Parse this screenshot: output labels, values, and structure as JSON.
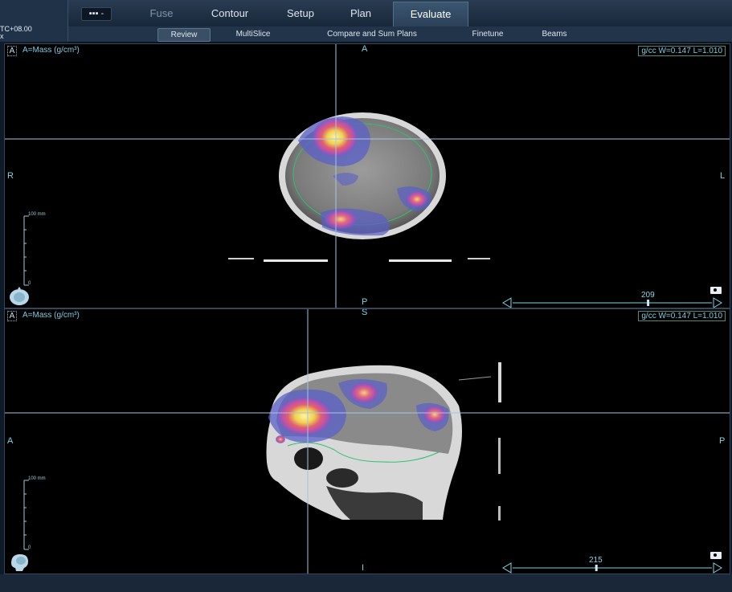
{
  "patient": {
    "line1": "TC+08.00",
    "line2": "x"
  },
  "menu": {
    "label": "▪▪▪ -"
  },
  "tabs": [
    {
      "label": "Fuse",
      "state": "dim"
    },
    {
      "label": "Contour",
      "state": "normal"
    },
    {
      "label": "Setup",
      "state": "normal"
    },
    {
      "label": "Plan",
      "state": "normal"
    },
    {
      "label": "Evaluate",
      "state": "active"
    }
  ],
  "subtabs": [
    {
      "label": "Review",
      "active": true
    },
    {
      "label": "MultiSlice",
      "active": false
    },
    {
      "label": "Compare and Sum Plans",
      "active": false
    },
    {
      "label": "Finetune",
      "active": false
    },
    {
      "label": "Beams",
      "active": false
    }
  ],
  "views": {
    "axial": {
      "badge": "A",
      "label": "A=Mass (g/cm³)",
      "wl": "g/cc W=0.147 L=1.010",
      "orient_top": "A",
      "orient_bottom": "P",
      "orient_left": "R",
      "orient_right": "L",
      "scale_top": "100 mm",
      "scale_bottom": "0",
      "slice": "209",
      "slice_fraction": 0.68,
      "head_icon": "head-top-view-icon"
    },
    "sagittal": {
      "badge": "A",
      "label": "A=Mass (g/cm³)",
      "wl": "g/cc W=0.147 L=1.010",
      "orient_top": "S",
      "orient_bottom": "I",
      "orient_left": "A",
      "orient_right": "P",
      "scale_top": "100 mm",
      "scale_bottom": "0",
      "slice": "215",
      "slice_fraction": 0.42,
      "head_icon": "head-side-view-icon"
    }
  },
  "colors": {
    "crosshair": "#a9c4e0",
    "dose_low": "#5a60c8",
    "dose_mid": "#d050a0",
    "dose_high": "#f0e060",
    "contour": "#30c070"
  }
}
